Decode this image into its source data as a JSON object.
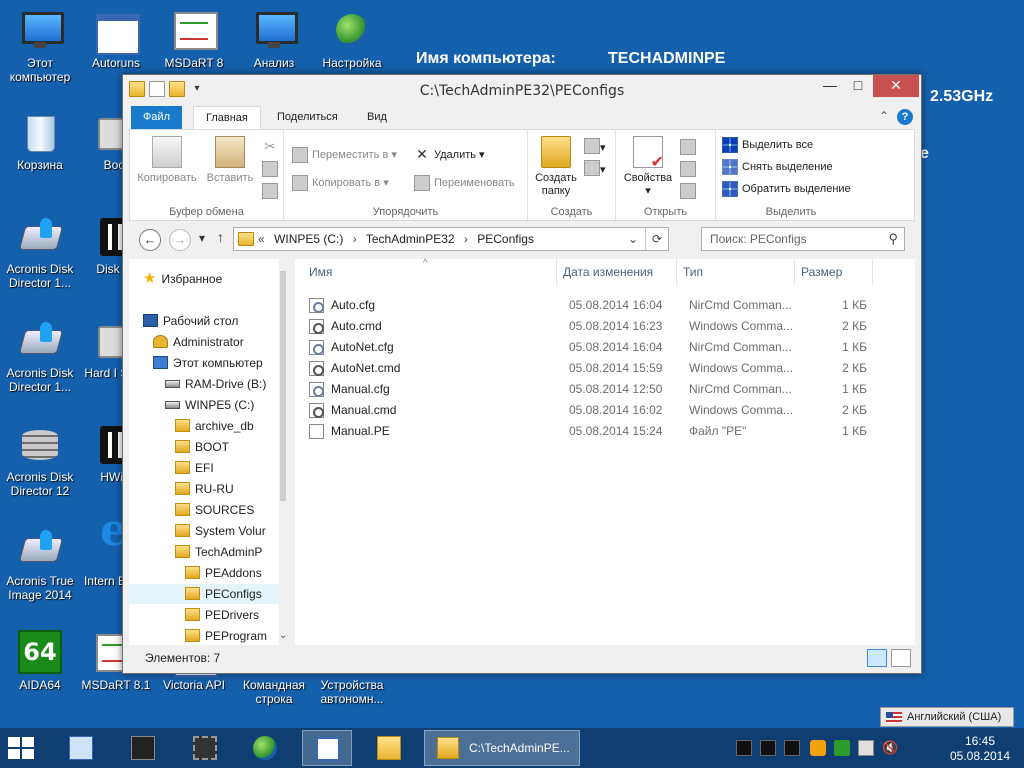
{
  "desktop": {
    "icons": [
      {
        "label": "Этот компьютер",
        "icon": "computer-icon"
      },
      {
        "label": "Autoruns",
        "icon": "autoruns-icon"
      },
      {
        "label": "MSDaRT 8",
        "icon": "msdart-icon"
      },
      {
        "label": "Анализ",
        "icon": "analysis-icon"
      },
      {
        "label": "Настройка",
        "icon": "settings-globe-icon"
      },
      {
        "label": "Корзина",
        "icon": "recycle-bin-icon"
      },
      {
        "label": "Boot",
        "icon": "boot-icon"
      },
      {
        "label": "Acronis Disk Director 1...",
        "icon": "acronis-icon"
      },
      {
        "label": "Disk Cr",
        "icon": "disk-icon"
      },
      {
        "label": "Acronis Disk Director 1...",
        "icon": "acronis-icon"
      },
      {
        "label": "Hard I Senti",
        "icon": "hard-disk-sentinel-icon"
      },
      {
        "label": "Acronis Disk Director 12",
        "icon": "acronis-icon"
      },
      {
        "label": "HWiN",
        "icon": "hwinfo-icon"
      },
      {
        "label": "Acronis True Image 2014",
        "icon": "acronis-true-image-icon"
      },
      {
        "label": "Intern Explo",
        "icon": "internet-explorer-icon"
      },
      {
        "label": "AIDA64",
        "icon": "aida64-icon"
      },
      {
        "label": "MSDaRT 8.1",
        "icon": "msdart-icon"
      },
      {
        "label": "Victoria API",
        "icon": "victoria-icon"
      },
      {
        "label": "Командная строка",
        "icon": "command-prompt-icon"
      },
      {
        "label": "Устройства автономн...",
        "icon": "devices-icon"
      }
    ],
    "aida_text": "64",
    "sysinfo": {
      "computer_label": "Имя компьютера:",
      "computer_value": "TECHADMINPE",
      "cpu_fragment": "2.53GHz",
      "edge_fragment": "e"
    }
  },
  "window": {
    "title": "C:\\TechAdminPE32\\PEConfigs",
    "controls": {
      "minimize": "—",
      "maximize": "□",
      "close": "✕"
    },
    "ribbon_tabs": [
      "Файл",
      "Главная",
      "Поделиться",
      "Вид"
    ],
    "ribbon": {
      "clipboard": {
        "copy": "Копировать",
        "paste": "Вставить",
        "group": "Буфер обмена"
      },
      "organize": {
        "move_to": "Переместить в",
        "copy_to": "Копировать в",
        "delete": "Удалить",
        "rename": "Переименовать",
        "group": "Упорядочить"
      },
      "new": {
        "new_folder_1": "Создать",
        "new_folder_2": "папку",
        "group": "Создать"
      },
      "open": {
        "properties": "Свойства",
        "group": "Открыть"
      },
      "select": {
        "select_all": "Выделить все",
        "select_none": "Снять выделение",
        "invert": "Обратить выделение",
        "group": "Выделить"
      },
      "collapse_glyph": "⌃",
      "help_glyph": "?"
    },
    "address": {
      "prefix": "«",
      "crumbs": [
        "WINPE5 (C:)",
        "TechAdminPE32",
        "PEConfigs"
      ],
      "separator": "›",
      "dropdown_glyph": "⌄",
      "refresh_glyph": "⟳"
    },
    "search_placeholder": "Поиск: PEConfigs",
    "nav": {
      "back_glyph": "←",
      "forward_glyph": "→",
      "recent_glyph": "▾",
      "up_glyph": "↑",
      "search_glyph": "⚲",
      "scroll_down_glyph": "⌄"
    },
    "nav_tree": [
      {
        "label": "Избранное",
        "icon": "star"
      },
      {
        "label": "Рабочий стол",
        "icon": "desk"
      },
      {
        "label": "Administrator",
        "icon": "user"
      },
      {
        "label": "Этот компьютер",
        "icon": "pc"
      },
      {
        "label": "RAM-Drive (B:)",
        "icon": "drive"
      },
      {
        "label": "WINPE5 (C:)",
        "icon": "drive"
      },
      {
        "label": "archive_db",
        "icon": "folder"
      },
      {
        "label": "BOOT",
        "icon": "folder"
      },
      {
        "label": "EFI",
        "icon": "folder"
      },
      {
        "label": "RU-RU",
        "icon": "folder"
      },
      {
        "label": "SOURCES",
        "icon": "folder"
      },
      {
        "label": "System Volur",
        "icon": "folder"
      },
      {
        "label": "TechAdminP",
        "icon": "folder"
      },
      {
        "label": "PEAddons",
        "icon": "folder"
      },
      {
        "label": "PEConfigs",
        "icon": "folder",
        "selected": true
      },
      {
        "label": "PEDrivers",
        "icon": "folder"
      },
      {
        "label": "PEProgram",
        "icon": "folder"
      }
    ],
    "columns": {
      "name": "Имя",
      "date": "Дата изменения",
      "type": "Тип",
      "size": "Размер",
      "sort_glyph": "^"
    },
    "files": [
      {
        "name": "Auto.cfg",
        "date": "05.08.2014 16:04",
        "type": "NirCmd Comman...",
        "size": "1 КБ",
        "kind": "cfg"
      },
      {
        "name": "Auto.cmd",
        "date": "05.08.2014 16:23",
        "type": "Windows Comma...",
        "size": "2 КБ",
        "kind": "cmd"
      },
      {
        "name": "AutoNet.cfg",
        "date": "05.08.2014 16:04",
        "type": "NirCmd Comman...",
        "size": "1 КБ",
        "kind": "cfg"
      },
      {
        "name": "AutoNet.cmd",
        "date": "05.08.2014 15:59",
        "type": "Windows Comma...",
        "size": "2 КБ",
        "kind": "cmd"
      },
      {
        "name": "Manual.cfg",
        "date": "05.08.2014 12:50",
        "type": "NirCmd Comman...",
        "size": "1 КБ",
        "kind": "cfg"
      },
      {
        "name": "Manual.cmd",
        "date": "05.08.2014 16:02",
        "type": "Windows Comma...",
        "size": "2 КБ",
        "kind": "cmd"
      },
      {
        "name": "Manual.PE",
        "date": "05.08.2014 15:24",
        "type": "Файл \"PE\"",
        "size": "1 КБ",
        "kind": "file"
      }
    ],
    "status": "Элементов: 7"
  },
  "language_bar": "Английский (США)",
  "taskbar": {
    "window_button": "C:\\TechAdminPE...",
    "time": "16:45",
    "date": "05.08.2014"
  },
  "colors": {
    "desktop": "#1560ad",
    "taskbar": "#0f3f72",
    "file_tab": "#1979ca"
  }
}
